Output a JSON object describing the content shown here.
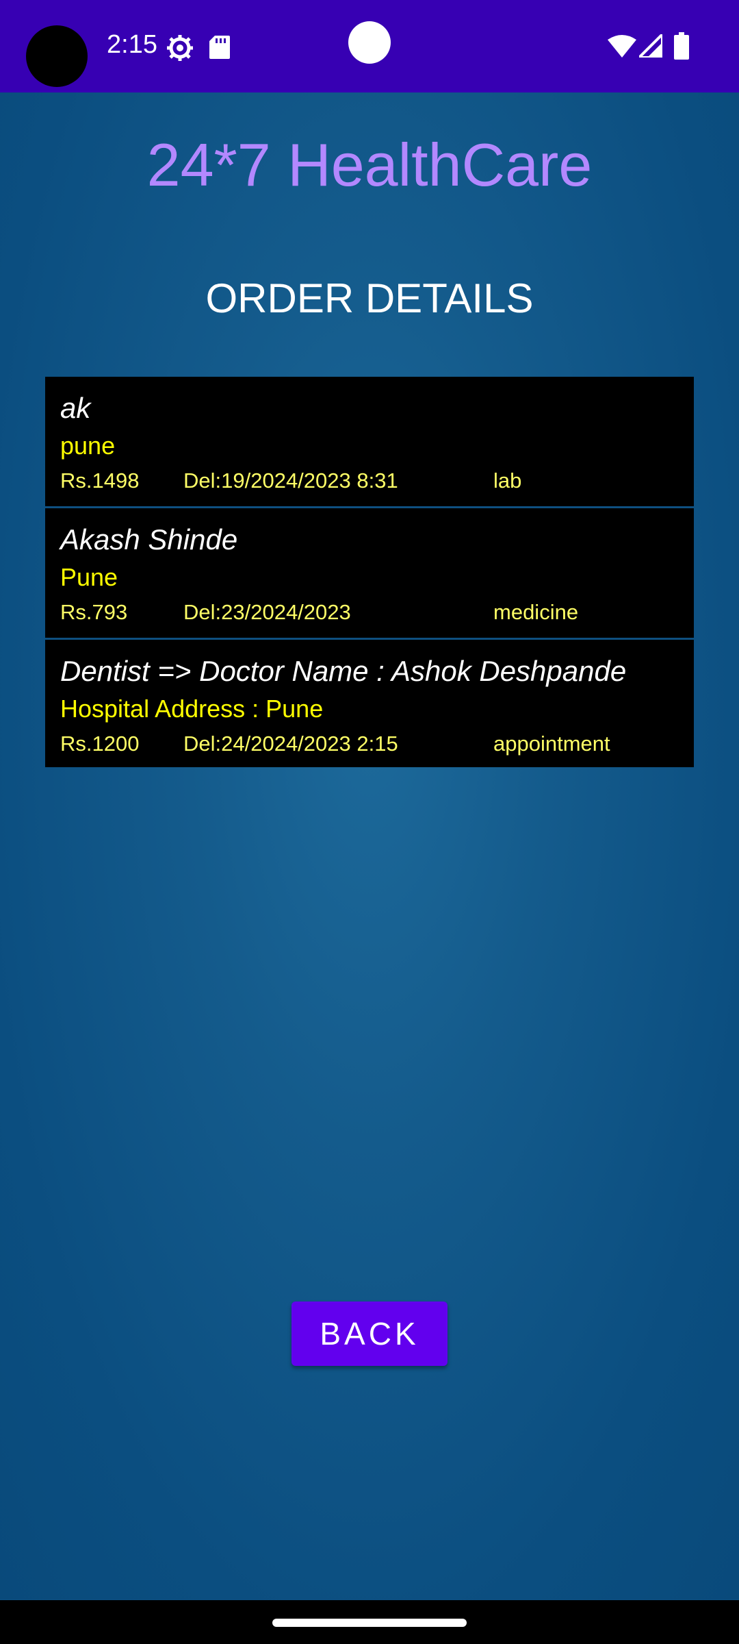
{
  "status_bar": {
    "time": "2:15",
    "icons": [
      "settings-icon",
      "sd-card-icon",
      "wifi-icon",
      "signal-icon",
      "battery-icon"
    ]
  },
  "app": {
    "title": "24*7 HealthCare"
  },
  "page": {
    "title": "ORDER DETAILS"
  },
  "orders": [
    {
      "title": "ak",
      "address": "pune",
      "price": "Rs.1498",
      "date": "Del:19/2024/2023 8:31",
      "type": "lab"
    },
    {
      "title": "Akash Shinde",
      "address": "Pune",
      "price": "Rs.793",
      "date": "Del:23/2024/2023",
      "type": "medicine"
    },
    {
      "title": "Dentist => Doctor Name : Ashok Deshpande",
      "address": "Hospital Address : Pune",
      "price": "Rs.1200",
      "date": "Del:24/2024/2023 2:15",
      "type": "appointment"
    }
  ],
  "actions": {
    "back_label": "BACK"
  },
  "colors": {
    "status_bar": "#3700b3",
    "title": "#b388ff",
    "accent_text": "#ffff00",
    "button": "#6200ee"
  }
}
